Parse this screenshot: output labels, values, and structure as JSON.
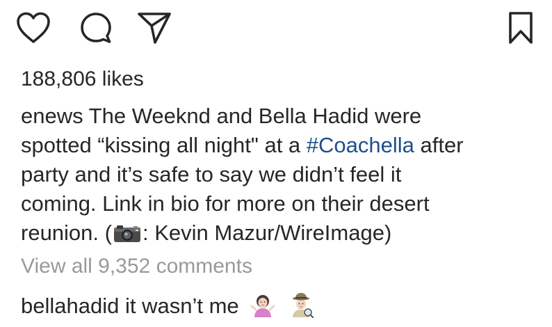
{
  "post": {
    "likes_text": "188,806 likes",
    "caption": {
      "username": "enews",
      "line1_text": "The Weeknd and Bella Hadid were",
      "line2_prefix": "spotted “kissing all night\" at a",
      "hashtag": "#Coachella",
      "line2_suffix": "after",
      "line3": "party and it’s safe to say we didn’t feel it",
      "line4": "coming. Link in bio for more on their desert",
      "line5_prefix": "reunion. (",
      "line5_suffix": ": Kevin Mazur/WireImage)"
    },
    "view_comments_text": "View all 9,352 comments",
    "comment": {
      "username": "bellahadid",
      "text": "it wasn’t me"
    }
  },
  "icons": {
    "like": "heart-outline-icon",
    "comment": "speech-bubble-icon",
    "share": "paper-plane-icon",
    "save": "bookmark-icon",
    "caption_emoji": "camera-emoji",
    "comment_emoji_1": "person-shrugging-emoji",
    "comment_emoji_2": "detective-emoji"
  },
  "colors": {
    "text": "#262626",
    "hashtag": "#1f4f8c",
    "muted": "#999999",
    "background": "#ffffff"
  }
}
